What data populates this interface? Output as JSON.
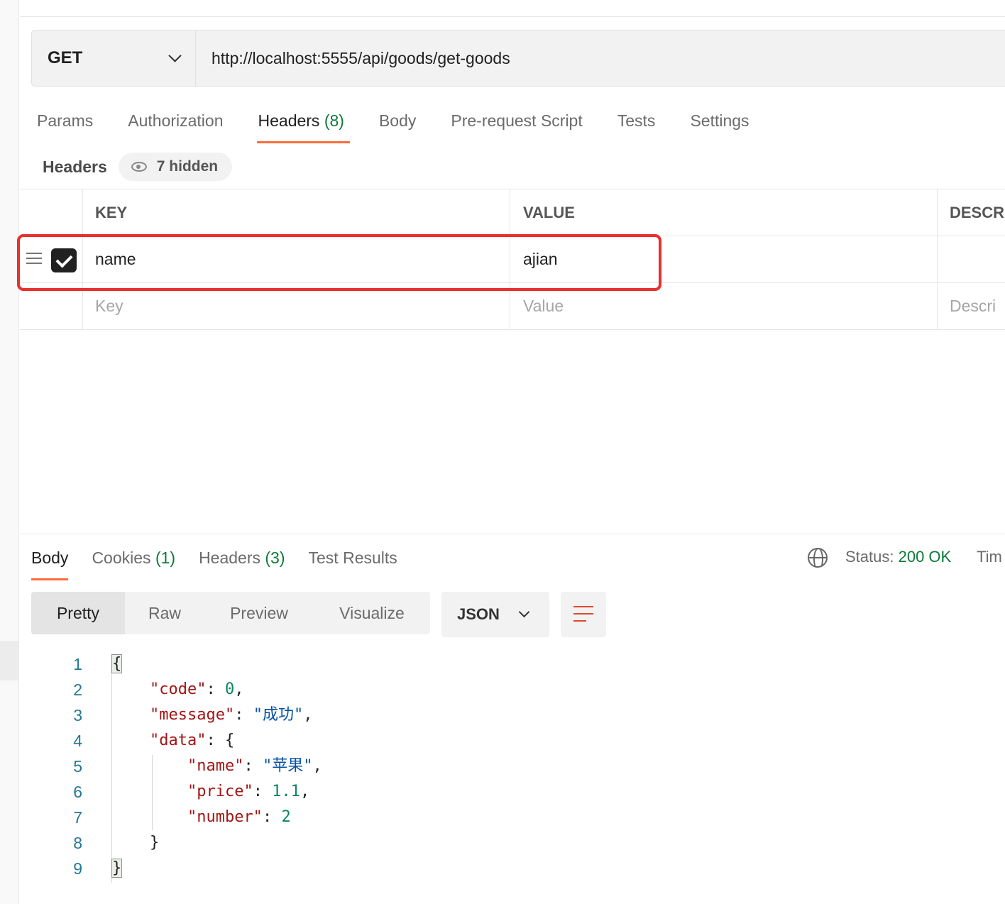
{
  "request": {
    "method": "GET",
    "url": "http://localhost:5555/api/goods/get-goods"
  },
  "request_tabs": [
    {
      "label": "Params",
      "count": ""
    },
    {
      "label": "Authorization",
      "count": ""
    },
    {
      "label": "Headers",
      "count": "(8)"
    },
    {
      "label": "Body",
      "count": ""
    },
    {
      "label": "Pre-request Script",
      "count": ""
    },
    {
      "label": "Tests",
      "count": ""
    },
    {
      "label": "Settings",
      "count": ""
    }
  ],
  "headers_section": {
    "title": "Headers",
    "hidden_label": "7 hidden",
    "columns": {
      "key": "KEY",
      "value": "VALUE",
      "description": "DESCR"
    },
    "rows": [
      {
        "key": "name",
        "value": "ajian",
        "description": "",
        "checked": true
      }
    ],
    "placeholders": {
      "key": "Key",
      "value": "Value",
      "description": "Descri"
    }
  },
  "response": {
    "tabs": [
      {
        "label": "Body",
        "count": ""
      },
      {
        "label": "Cookies",
        "count": "(1)"
      },
      {
        "label": "Headers",
        "count": "(3)"
      },
      {
        "label": "Test Results",
        "count": ""
      }
    ],
    "status_label": "Status:",
    "status_value": "200 OK",
    "time_label": "Tim",
    "view_modes": [
      "Pretty",
      "Raw",
      "Preview",
      "Visualize"
    ],
    "format": "JSON"
  },
  "code": {
    "line_numbers": [
      "1",
      "2",
      "3",
      "4",
      "5",
      "6",
      "7",
      "8",
      "9"
    ],
    "open_brace": "{",
    "close_brace": "}",
    "code_key": "\"code\"",
    "code_val": "0",
    "message_key": "\"message\"",
    "message_val": "\"成功\"",
    "data_key": "\"data\"",
    "name_key": "\"name\"",
    "name_val": "\"苹果\"",
    "price_key": "\"price\"",
    "price_val": "1.1",
    "number_key": "\"number\"",
    "number_val": "2"
  },
  "colors": {
    "accent": "#ff6c37",
    "success": "#0c7a3a",
    "highlight_border": "#e8302c"
  },
  "icons": [
    "drag-handle-icon",
    "checkbox-checked-icon",
    "eye-icon",
    "chevron-down-icon",
    "globe-icon",
    "wrap-lines-icon"
  ]
}
